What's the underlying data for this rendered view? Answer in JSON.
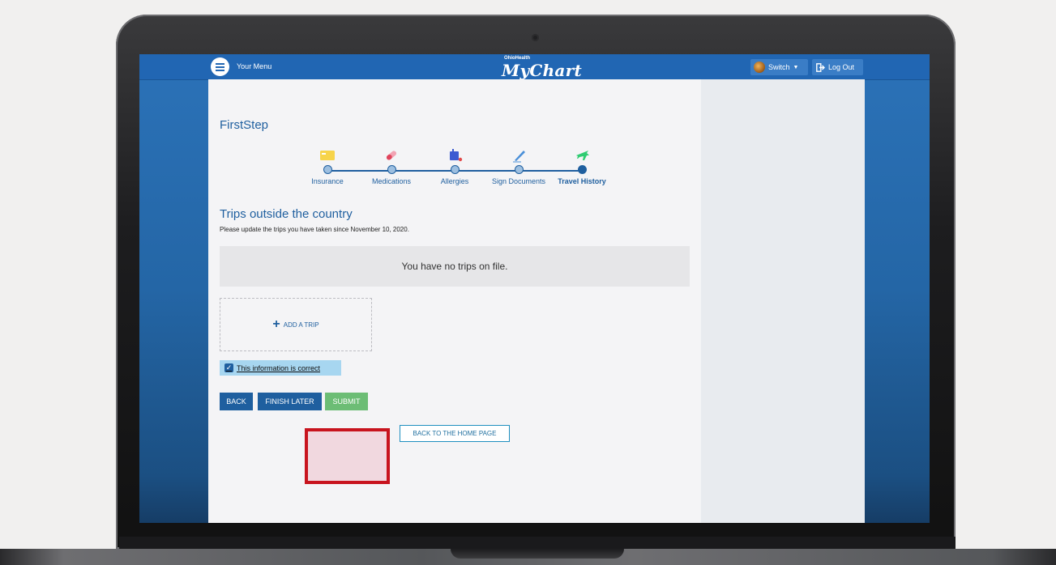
{
  "header": {
    "menu_label": "Your Menu",
    "brand_small": "OhioHealth",
    "brand": "MyChart",
    "switch_label": "Switch",
    "logout_label": "Log Out"
  },
  "page": {
    "title": "FirstStep",
    "steps": [
      {
        "label": "Insurance",
        "icon": "insurance-card-icon",
        "active": false
      },
      {
        "label": "Medications",
        "icon": "pill-icon",
        "active": false
      },
      {
        "label": "Allergies",
        "icon": "allergy-icon",
        "active": false
      },
      {
        "label": "Sign Documents",
        "icon": "pen-icon",
        "active": false
      },
      {
        "label": "Travel History",
        "icon": "airplane-icon",
        "active": true
      }
    ],
    "section_title": "Trips outside the country",
    "section_sub": "Please update the trips you have taken since November 10, 2020.",
    "empty_message": "You have no trips on file.",
    "add_trip_label": "ADD A TRIP",
    "confirm_label": "This information is correct",
    "confirm_checked": true,
    "buttons": {
      "back": "BACK",
      "finish_later": "FINISH LATER",
      "submit": "SUBMIT",
      "home": "BACK TO THE HOME PAGE"
    }
  },
  "colors": {
    "header_blue": "#2166b3",
    "accent": "#1f5f9f",
    "submit_green": "#6cbd75",
    "highlight_red": "#c8141e"
  }
}
